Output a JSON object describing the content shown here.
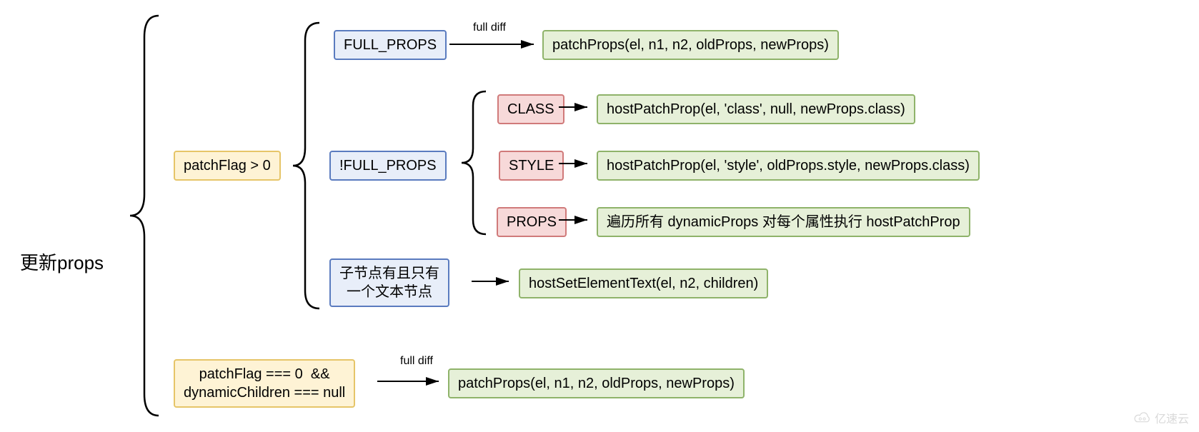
{
  "root": {
    "label": "更新props"
  },
  "branch1": {
    "condition": "patchFlag > 0",
    "full_props": {
      "label": "FULL_PROPS",
      "arrow_note": "full diff",
      "result": "patchProps(el, n1, n2, oldProps, newProps)"
    },
    "not_full_props": {
      "label": "!FULL_PROPS",
      "class_case": {
        "label": "CLASS",
        "result": "hostPatchProp(el, 'class', null, newProps.class)"
      },
      "style_case": {
        "label": "STYLE",
        "result": "hostPatchProp(el, 'style', oldProps.style, newProps.class)"
      },
      "props_case": {
        "label": "PROPS",
        "result": "遍历所有 dynamicProps 对每个属性执行 hostPatchProp"
      }
    },
    "text_child": {
      "label": "子节点有且只有\n一个文本节点",
      "result": "hostSetElementText(el, n2, children)"
    }
  },
  "branch2": {
    "condition": "patchFlag === 0  &&\ndynamicChildren === null",
    "arrow_note": "full diff",
    "result": "patchProps(el, n1, n2, oldProps, newProps)"
  },
  "watermark": "亿速云"
}
